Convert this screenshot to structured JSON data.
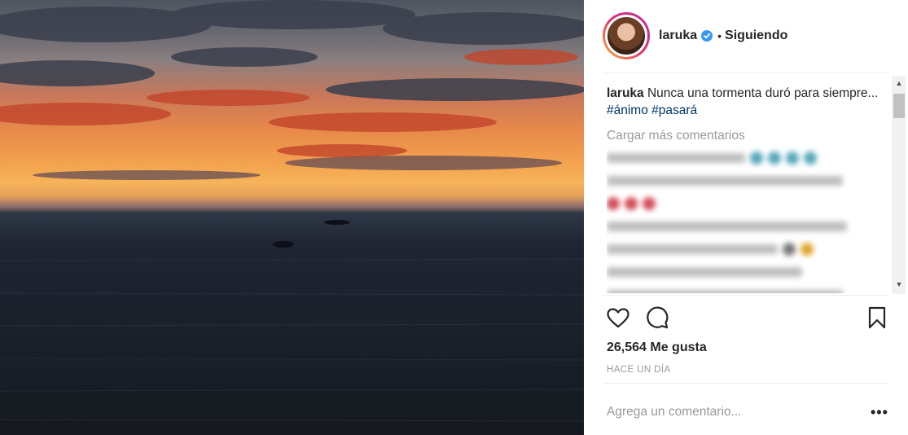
{
  "post": {
    "username": "laruka",
    "separator": "•",
    "follow_status": "Siguiendo",
    "caption_user": "laruka",
    "caption_text": "Nunca una tormenta duró para siempre... ",
    "hashtags": [
      "#ánimo",
      "#pasará"
    ],
    "load_more": "Cargar más comentarios",
    "likes": "26,564 Me gusta",
    "time_ago": "HACE UN DÍA",
    "comment_placeholder": "Agrega un comentario...",
    "more_options": "•••"
  },
  "icons": {
    "like": "heart-icon",
    "comment": "comment-icon",
    "save": "bookmark-icon",
    "verified": "verified-badge-icon"
  },
  "colors": {
    "verified": "#3897f0",
    "hashtag": "#003569",
    "muted": "#999999"
  }
}
